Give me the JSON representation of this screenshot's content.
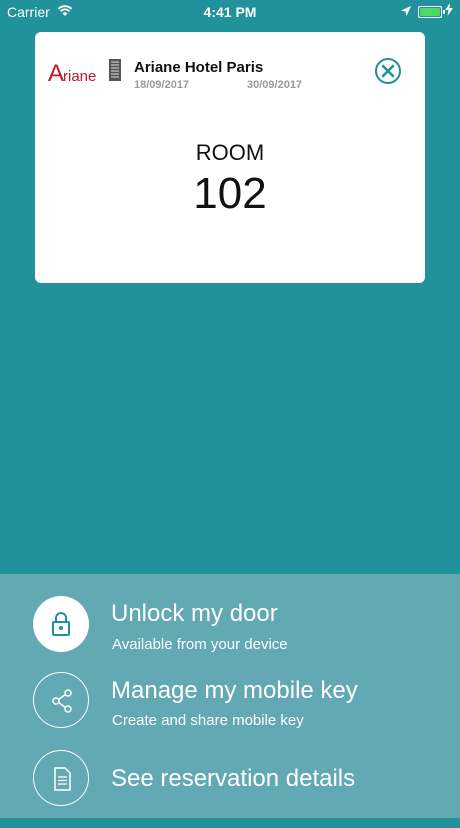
{
  "status_bar": {
    "carrier": "Carrier",
    "time": "4:41 PM"
  },
  "reservation": {
    "logo_text": "Ariane",
    "hotel_name": "Ariane Hotel Paris",
    "start_date": "18/09/2017",
    "end_date": "30/09/2017",
    "room_label": "ROOM",
    "room_number": "102"
  },
  "actions": [
    {
      "title": "Unlock my door",
      "subtitle": "Available from your device",
      "icon": "lock-icon"
    },
    {
      "title": "Manage my mobile key",
      "subtitle": "Create and share mobile key",
      "icon": "share-icon"
    },
    {
      "title": "See reservation details",
      "subtitle": "",
      "icon": "document-icon"
    }
  ],
  "colors": {
    "background": "#21929c",
    "panel": "#62a9b3",
    "logo_red": "#c0192a",
    "battery_green": "#4cd964"
  }
}
